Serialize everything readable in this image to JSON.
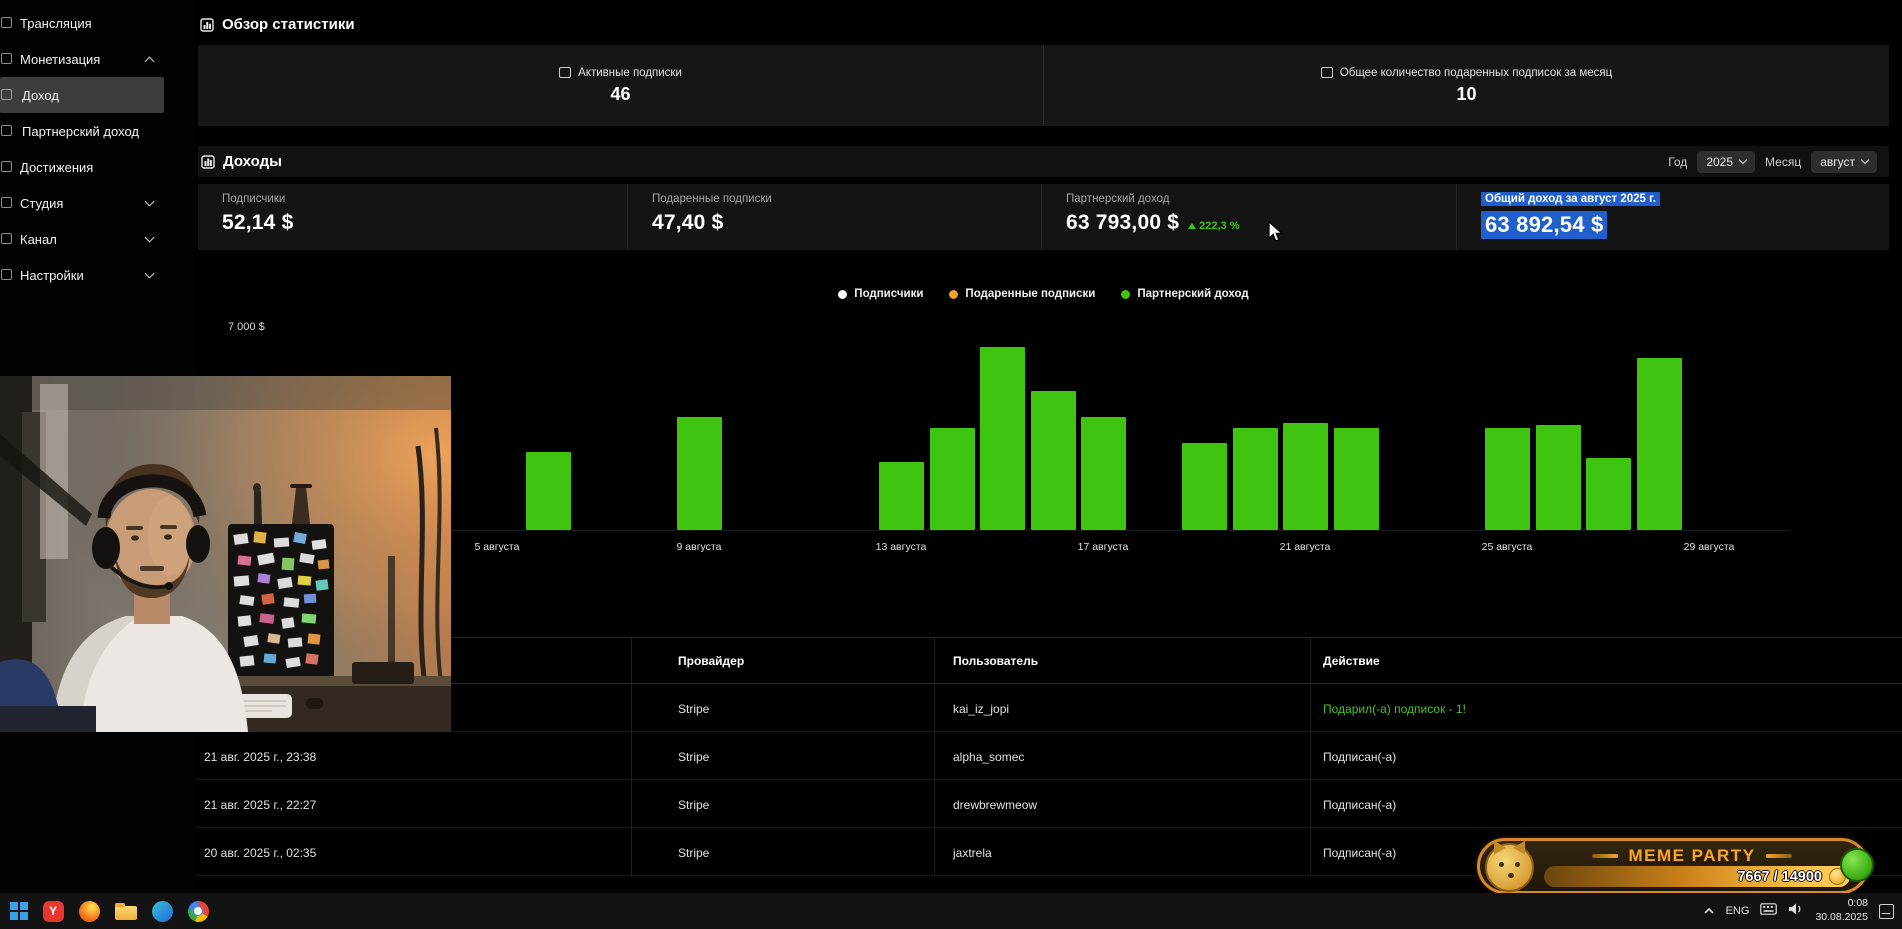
{
  "sidebar": {
    "items": [
      {
        "id": "broadcast",
        "label": "Трансляция",
        "level": 0,
        "chevron": null,
        "selected": false
      },
      {
        "id": "monetization",
        "label": "Монетизация",
        "level": 0,
        "chevron": "up",
        "selected": false
      },
      {
        "id": "income",
        "label": "Доход",
        "level": 1,
        "chevron": null,
        "selected": true
      },
      {
        "id": "partner-income",
        "label": "Партнерский доход",
        "level": 1,
        "chevron": null,
        "selected": false
      },
      {
        "id": "achievements",
        "label": "Достижения",
        "level": 0,
        "chevron": null,
        "selected": false
      },
      {
        "id": "studio",
        "label": "Студия",
        "level": 0,
        "chevron": "down",
        "selected": false
      },
      {
        "id": "channel",
        "label": "Канал",
        "level": 0,
        "chevron": "down",
        "selected": false
      },
      {
        "id": "settings",
        "label": "Настройки",
        "level": 0,
        "chevron": "down",
        "selected": false
      }
    ]
  },
  "overview": {
    "title": "Обзор статистики",
    "cards": [
      {
        "label": "Активные подписки",
        "value": "46"
      },
      {
        "label": "Общее количество подаренных подписок за месяц",
        "value": "10"
      }
    ]
  },
  "income": {
    "title": "Доходы",
    "filters": {
      "year_label": "Год",
      "year_value": "2025",
      "month_label": "Месяц",
      "month_value": "август"
    },
    "stats": [
      {
        "label": "Подписчики",
        "value": "52,14 $",
        "delta": null,
        "highlighted": false
      },
      {
        "label": "Подаренные подписки",
        "value": "47,40 $",
        "delta": null,
        "highlighted": false
      },
      {
        "label": "Партнерский доход",
        "value": "63 793,00 $",
        "delta": "222,3 %",
        "highlighted": false
      },
      {
        "label": "Общий доход за август 2025 г.",
        "value": "63 892,54 $",
        "delta": null,
        "highlighted": true
      }
    ]
  },
  "chart_data": {
    "type": "bar",
    "title": "",
    "xlabel": "",
    "ylabel": "",
    "ylim": [
      0,
      7000
    ],
    "y_top_label": "7 000 $",
    "grid": false,
    "legend_position": "top-center",
    "legend": [
      {
        "label": "Подписчики",
        "color": "#ffffff"
      },
      {
        "label": "Подаренные подписки",
        "color": "#f0a32a"
      },
      {
        "label": "Партнерский доход",
        "color": "#3fc40f"
      }
    ],
    "x_ticks": [
      {
        "day": 5,
        "label": "5 августа"
      },
      {
        "day": 9,
        "label": "9 августа"
      },
      {
        "day": 13,
        "label": "13 августа"
      },
      {
        "day": 17,
        "label": "17 августа"
      },
      {
        "day": 21,
        "label": "21 августа"
      },
      {
        "day": 25,
        "label": "25 августа"
      },
      {
        "day": 29,
        "label": "29 августа"
      }
    ],
    "series": [
      {
        "name": "Партнерский доход",
        "color": "#3fc40f",
        "points": [
          {
            "day": 6,
            "value": 2700
          },
          {
            "day": 9,
            "value": 3900
          },
          {
            "day": 13,
            "value": 2350
          },
          {
            "day": 14,
            "value": 3550
          },
          {
            "day": 15,
            "value": 6350
          },
          {
            "day": 16,
            "value": 4800
          },
          {
            "day": 17,
            "value": 3900
          },
          {
            "day": 19,
            "value": 3000
          },
          {
            "day": 20,
            "value": 3550
          },
          {
            "day": 21,
            "value": 3700
          },
          {
            "day": 22,
            "value": 3550
          },
          {
            "day": 25,
            "value": 3550
          },
          {
            "day": 26,
            "value": 3650
          },
          {
            "day": 27,
            "value": 2500
          },
          {
            "day": 28,
            "value": 5950
          }
        ]
      }
    ]
  },
  "table": {
    "headers": [
      "",
      "Провайдер",
      "Пользователь",
      "Действие"
    ],
    "rows": [
      {
        "date": "",
        "provider": "Stripe",
        "user": "kai_iz_jopi",
        "action": "Подарил(-а) подписок - 1!",
        "action_type": "gift"
      },
      {
        "date": "21 авг. 2025 г., 23:38",
        "provider": "Stripe",
        "user": "alpha_somec",
        "action": "Подписан(-а)",
        "action_type": "sub"
      },
      {
        "date": "21 авг. 2025 г., 22:27",
        "provider": "Stripe",
        "user": "drewbrewmeow",
        "action": "Подписан(-а)",
        "action_type": "sub"
      },
      {
        "date": "20 авг. 2025 г., 02:35",
        "provider": "Stripe",
        "user": "jaxtrela",
        "action": "Подписан(-а)",
        "action_type": "sub"
      }
    ]
  },
  "meme_party": {
    "title": "MEME PARTY",
    "progress": "7667 / 14900"
  },
  "taskbar": {
    "lang": "ENG",
    "time": "0:08",
    "date": "30.08.2025",
    "apps": [
      {
        "name": "yandex-browser",
        "color": "#e8372c",
        "glyph": "Y"
      },
      {
        "name": "firefox",
        "color": "#f57c1f",
        "glyph": ""
      },
      {
        "name": "file-explorer",
        "color": "#f2c14a",
        "glyph": ""
      },
      {
        "name": "edge",
        "color": "#2aa3d8",
        "glyph": ""
      },
      {
        "name": "chrome",
        "color": "#4caf50",
        "glyph": ""
      }
    ]
  },
  "colors": {
    "green_accent": "#3fc40f",
    "orange_accent": "#f0a32a",
    "selection_blue": "#2160cc",
    "panel_dark": "#161616"
  }
}
